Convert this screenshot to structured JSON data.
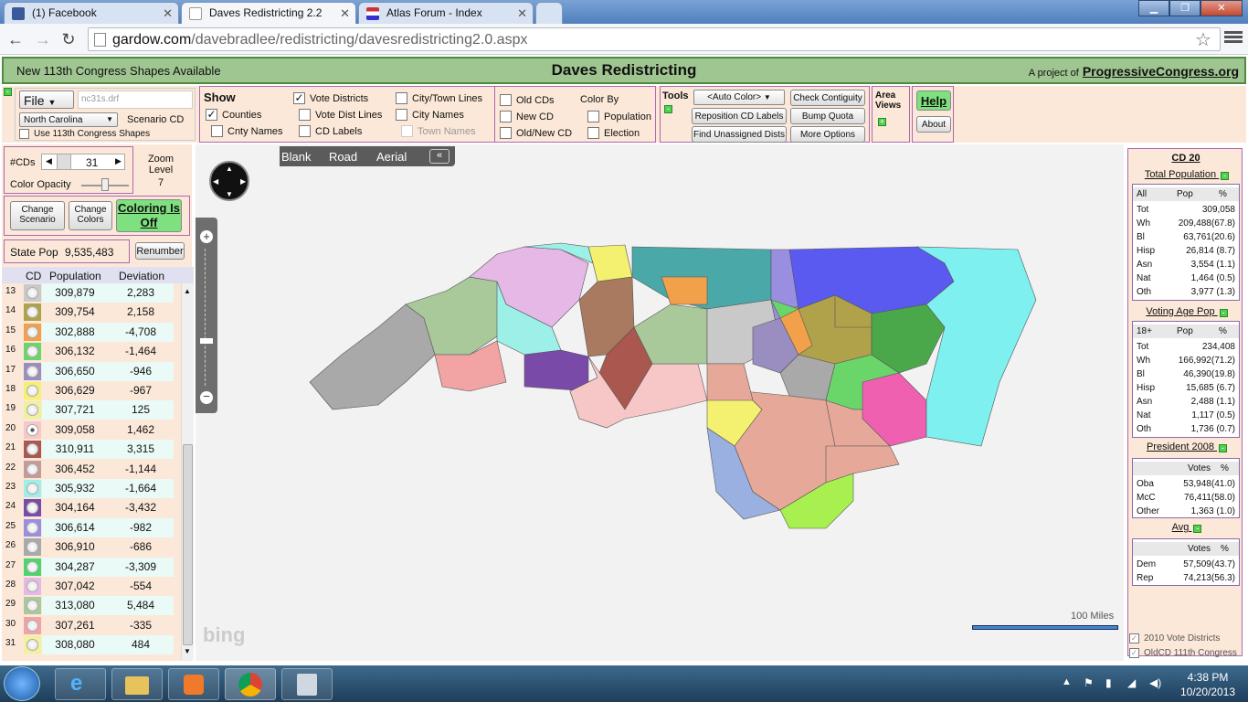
{
  "browser": {
    "tabs": [
      {
        "label": "(1) Facebook",
        "color": "#3b5998"
      },
      {
        "label": "Daves Redistricting 2.2",
        "color": "#ffffff"
      },
      {
        "label": "Atlas Forum - Index",
        "color": "#7a2a8a"
      }
    ],
    "url_host": "gardow.com",
    "url_path": "/davebradlee/redistricting/davesredistricting2.0.aspx"
  },
  "header": {
    "left": "New 113th Congress Shapes Available",
    "title": "Daves Redistricting",
    "right_prefix": "A project of",
    "right_link": "ProgressiveCongress.org"
  },
  "controls": {
    "file_label": "File",
    "filename": "nc31s.drf",
    "state": "North Carolina",
    "scenario": "Scenario CD",
    "use113": "Use 113th Congress Shapes",
    "show": "Show",
    "counties": "Counties",
    "cnty_names": "Cnty Names",
    "vote_districts": "Vote Districts",
    "vote_dist_lines": "Vote Dist Lines",
    "cd_labels": "CD Labels",
    "city_town_lines": "City/Town Lines",
    "city_names": "City Names",
    "town_names": "Town Names",
    "old_cds": "Old CDs",
    "new_cd": "New CD",
    "old_new_cd": "Old/New CD",
    "color_by": "Color By",
    "population": "Population",
    "election": "Election",
    "tools": "Tools",
    "auto_color": "<Auto Color>",
    "reposition": "Reposition CD Labels",
    "find_unassigned": "Find Unassigned Dists",
    "check_contiguity": "Check Contiguity",
    "bump_quota": "Bump Quota",
    "more_options": "More Options",
    "area_views": "Area Views",
    "help": "Help",
    "about": "About"
  },
  "left": {
    "cds_label": "#CDs",
    "cds_value": "31",
    "opacity_label": "Color Opacity",
    "zoom_label": "Zoom Level",
    "zoom_value": "7",
    "change_scenario": "Change Scenario",
    "change_colors": "Change Colors",
    "coloring": "Coloring Is Off",
    "state_pop_label": "State Pop",
    "state_pop": "9,535,483",
    "renumber": "Renumber",
    "col_cd": "CD",
    "col_pop": "Population",
    "col_dev": "Deviation",
    "rows": [
      {
        "cd": "13",
        "color": "#c9c9c9",
        "pop": "309,879",
        "dev": "2,283"
      },
      {
        "cd": "14",
        "color": "#b0a24a",
        "pop": "309,754",
        "dev": "2,158"
      },
      {
        "cd": "15",
        "color": "#f2a04a",
        "pop": "302,888",
        "dev": "-4,708"
      },
      {
        "cd": "16",
        "color": "#6ad66a",
        "pop": "306,132",
        "dev": "-1,464"
      },
      {
        "cd": "17",
        "color": "#9a8ec0",
        "pop": "306,650",
        "dev": "-946"
      },
      {
        "cd": "18",
        "color": "#f4f070",
        "pop": "306,629",
        "dev": "-967"
      },
      {
        "cd": "19",
        "color": "#eef29a",
        "pop": "307,721",
        "dev": "125"
      },
      {
        "cd": "20",
        "color": "#f7c6c6",
        "pop": "309,058",
        "dev": "1,462"
      },
      {
        "cd": "21",
        "color": "#a9574f",
        "pop": "310,911",
        "dev": "3,315"
      },
      {
        "cd": "22",
        "color": "#c79a9a",
        "pop": "306,452",
        "dev": "-1,144"
      },
      {
        "cd": "23",
        "color": "#9cf0e8",
        "pop": "305,932",
        "dev": "-1,664"
      },
      {
        "cd": "24",
        "color": "#7a4aa8",
        "pop": "304,164",
        "dev": "-3,432"
      },
      {
        "cd": "25",
        "color": "#9a8ee0",
        "pop": "306,614",
        "dev": "-982"
      },
      {
        "cd": "26",
        "color": "#a9a9a9",
        "pop": "306,910",
        "dev": "-686"
      },
      {
        "cd": "27",
        "color": "#4ad66a",
        "pop": "304,287",
        "dev": "-3,309"
      },
      {
        "cd": "28",
        "color": "#e6b8e6",
        "pop": "307,042",
        "dev": "-554"
      },
      {
        "cd": "29",
        "color": "#a9c99a",
        "pop": "313,080",
        "dev": "5,484"
      },
      {
        "cd": "30",
        "color": "#f2a4a4",
        "pop": "307,261",
        "dev": "-335"
      },
      {
        "cd": "31",
        "color": "#f2f29a",
        "pop": "308,080",
        "dev": "484"
      }
    ]
  },
  "map": {
    "blank": "Blank",
    "road": "Road",
    "aerial": "Aerial",
    "scale": "100 Miles",
    "logo": "bing"
  },
  "right": {
    "title": "CD 20",
    "tp_title": "Total Population",
    "tp_head": [
      "All",
      "Pop",
      "%"
    ],
    "tp": [
      [
        "Tot",
        "309,058"
      ],
      [
        "Wh",
        "209,488(67.8)"
      ],
      [
        "Bl",
        "63,761(20.6)"
      ],
      [
        "Hisp",
        "26,814 (8.7)"
      ],
      [
        "Asn",
        "3,554 (1.1)"
      ],
      [
        "Nat",
        "1,464 (0.5)"
      ],
      [
        "Oth",
        "3,977 (1.3)"
      ]
    ],
    "va_title": "Voting Age Pop",
    "va_head": [
      "18+",
      "Pop",
      "%"
    ],
    "va": [
      [
        "Tot",
        "234,408"
      ],
      [
        "Wh",
        "166,992(71.2)"
      ],
      [
        "Bl",
        "46,390(19.8)"
      ],
      [
        "Hisp",
        "15,685 (6.7)"
      ],
      [
        "Asn",
        "2,488 (1.1)"
      ],
      [
        "Nat",
        "1,117 (0.5)"
      ],
      [
        "Oth",
        "1,736 (0.7)"
      ]
    ],
    "pres_title": "President 2008",
    "pres_head": [
      "Votes",
      "%"
    ],
    "pres": [
      [
        "Oba",
        "53,948(41.0)"
      ],
      [
        "McC",
        "76,411(58.0)"
      ],
      [
        "Other",
        "1,363 (1.0)"
      ]
    ],
    "avg_title": "Avg",
    "avg_head": [
      "Votes",
      "%"
    ],
    "avg": [
      [
        "Dem",
        "57,509(43.7)"
      ],
      [
        "Rep",
        "74,213(56.3)"
      ]
    ],
    "foot1": "2010 Vote Districts",
    "foot2": "OldCD 111th Congress"
  },
  "taskbar": {
    "time": "4:38 PM",
    "date": "10/20/2013"
  }
}
